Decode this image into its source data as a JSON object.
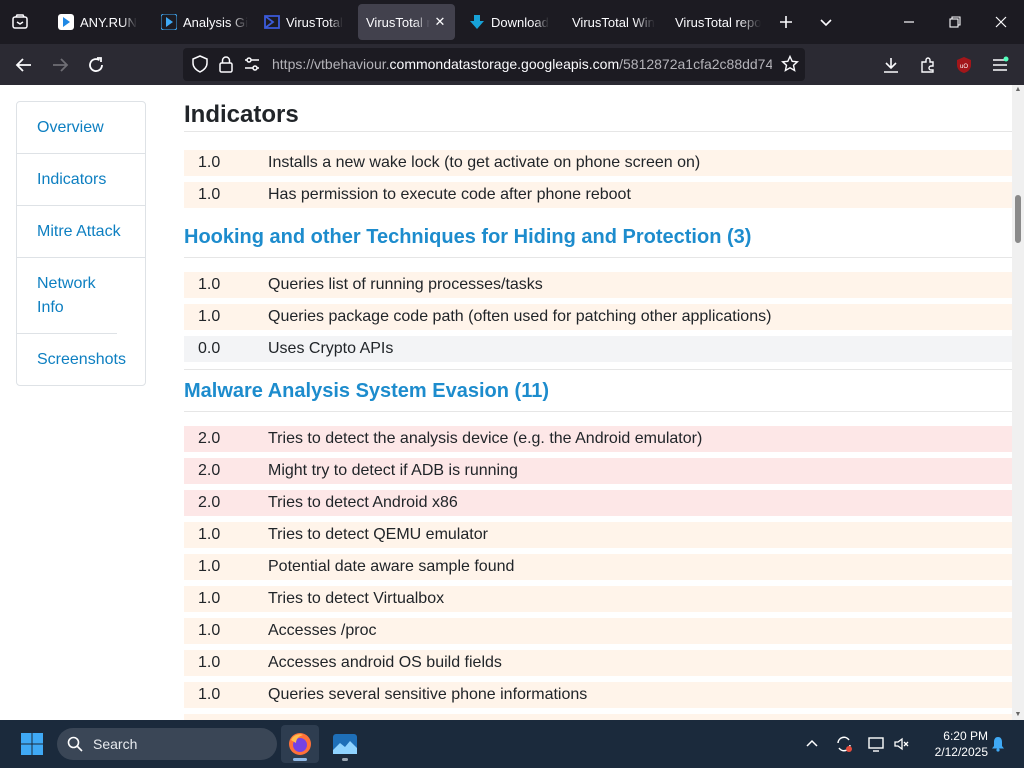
{
  "tabs": [
    {
      "label": "ANY.RUN",
      "favicon": "anyrun-icon"
    },
    {
      "label": "Analysis Gi",
      "favicon": "anyrun-icon"
    },
    {
      "label": "VirusTotal",
      "favicon": "virustotal-icon"
    },
    {
      "label": "VirusTotal re",
      "favicon": "none",
      "active": true
    },
    {
      "label": "Download",
      "favicon": "download-icon"
    },
    {
      "label": "VirusTotal Win",
      "favicon": "none"
    },
    {
      "label": "VirusTotal repo",
      "favicon": "none"
    }
  ],
  "address": {
    "prefix": "https://vtbehaviour.",
    "domain": "commondatastorage.googleapis.com",
    "path": "/5812872a1cfa2c88dd74"
  },
  "sidebar": {
    "items": [
      {
        "label": "Overview"
      },
      {
        "label": "Indicators"
      },
      {
        "label": "Mitre Attack"
      },
      {
        "label": "Network Info"
      },
      {
        "label": "Screenshots"
      }
    ]
  },
  "main": {
    "title": "Indicators",
    "top_rows": [
      {
        "score": "1.0",
        "desc": "Installs a new wake lock (to get activate on phone screen on)",
        "severity": "warn"
      },
      {
        "score": "1.0",
        "desc": "Has permission to execute code after phone reboot",
        "severity": "warn"
      }
    ],
    "sections": [
      {
        "heading": "Hooking and other Techniques for Hiding and Protection (3)",
        "rows": [
          {
            "score": "1.0",
            "desc": "Queries list of running processes/tasks",
            "severity": "warn"
          },
          {
            "score": "1.0",
            "desc": "Queries package code path (often used for patching other applications)",
            "severity": "warn"
          },
          {
            "score": "0.0",
            "desc": "Uses Crypto APIs",
            "severity": "info"
          }
        ]
      },
      {
        "heading": "Malware Analysis System Evasion (11)",
        "rows": [
          {
            "score": "2.0",
            "desc": "Tries to detect the analysis device (e.g. the Android emulator)",
            "severity": "danger"
          },
          {
            "score": "2.0",
            "desc": "Might try to detect if ADB is running",
            "severity": "danger"
          },
          {
            "score": "2.0",
            "desc": "Tries to detect Android x86",
            "severity": "danger"
          },
          {
            "score": "1.0",
            "desc": "Tries to detect QEMU emulator",
            "severity": "warn"
          },
          {
            "score": "1.0",
            "desc": "Potential date aware sample found",
            "severity": "warn"
          },
          {
            "score": "1.0",
            "desc": "Tries to detect Virtualbox",
            "severity": "warn"
          },
          {
            "score": "1.0",
            "desc": "Accesses /proc",
            "severity": "warn"
          },
          {
            "score": "1.0",
            "desc": "Accesses android OS build fields",
            "severity": "warn"
          },
          {
            "score": "1.0",
            "desc": "Queries several sensitive phone informations",
            "severity": "warn"
          }
        ]
      }
    ]
  },
  "taskbar": {
    "search_label": "Search",
    "time": "6:20 PM",
    "date": "2/12/2025"
  },
  "colors": {
    "link": "#1d8ccd",
    "warn_row": "#fff4ea",
    "danger_row": "#fde7e7",
    "info_row": "#f3f4f6"
  }
}
